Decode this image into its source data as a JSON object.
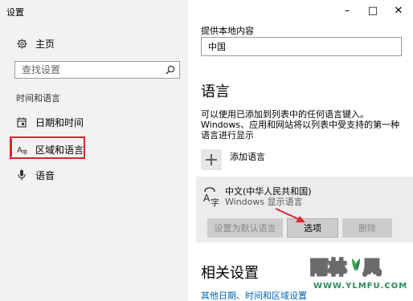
{
  "window": {
    "title": "设置",
    "controls": {
      "minimize": "–",
      "maximize": "□",
      "close": "✕"
    }
  },
  "sidebar": {
    "home": {
      "icon": "gear-icon",
      "label": "主页"
    },
    "search": {
      "placeholder": "查找设置",
      "icon": "search-icon"
    },
    "section_label": "时间和语言",
    "items": [
      {
        "icon": "calendar-icon",
        "label": "日期和时间",
        "active": false
      },
      {
        "icon": "region-language-icon",
        "label": "区域和语言",
        "active": true
      },
      {
        "icon": "microphone-icon",
        "label": "语音",
        "active": false
      }
    ]
  },
  "content": {
    "country_label": "提供本地内容",
    "country_value": "中国",
    "language_heading": "语言",
    "language_desc": "可以使用已添加到列表中的任何语言键入。Windows、应用和网站将以列表中受支持的第一种语言进行显示",
    "add_language": {
      "icon": "plus-icon",
      "label": "添加语言"
    },
    "languages": [
      {
        "icon": "language-glyph-icon",
        "name": "中文(中华人民共和国)",
        "subtitle": "Windows 显示语言",
        "buttons": {
          "set_default": "设置为默认语言",
          "options": "选项",
          "delete": "删除"
        }
      }
    ],
    "related_heading": "相关设置",
    "related_link": "其他日期、时间和区域设置"
  },
  "watermark": {
    "brand_text": "雨林木风",
    "url": "WWW.YLMFU.COM"
  },
  "colors": {
    "highlight_border": "#d8272d",
    "arrow": "#d8272d",
    "accent": "#0078d7",
    "link": "#0063b1"
  }
}
